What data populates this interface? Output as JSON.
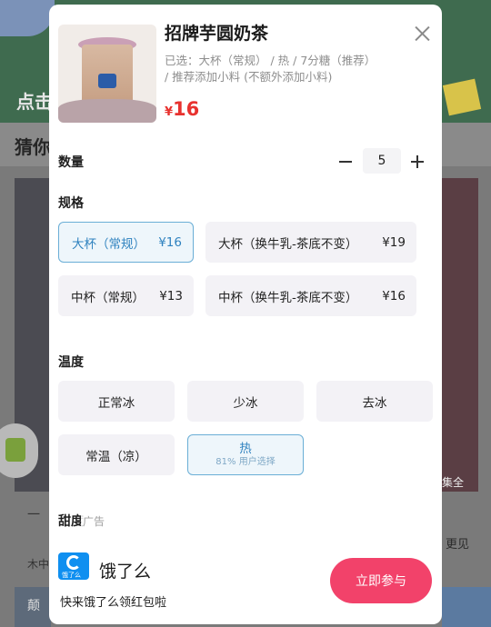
{
  "background": {
    "banner_text": "点击",
    "section_title": "猜你",
    "right_caption": "集全",
    "right_text": "更见",
    "left_meta1": "一",
    "left_meta2": "木中",
    "left_bar_text": "颠"
  },
  "product": {
    "name": "招牌芋圆奶茶",
    "selected_line1": "已选：大杯（常规） / 热 / 7分糖（推荐）",
    "selected_line2": "/ 推荐添加小料 (不额外添加小料)",
    "price_currency": "¥",
    "price_value": "16"
  },
  "quantity": {
    "label": "数量",
    "value": "5"
  },
  "spec": {
    "label": "规格",
    "options": [
      {
        "name": "大杯（常规）",
        "price": "¥16"
      },
      {
        "name": "大杯（换牛乳-茶底不变）",
        "price": "¥19"
      },
      {
        "name": "中杯（常规）",
        "price": "¥13"
      },
      {
        "name": "中杯（换牛乳-茶底不变）",
        "price": "¥16"
      }
    ]
  },
  "temperature": {
    "label": "温度",
    "options": [
      "正常冰",
      "少冰",
      "去冰",
      "常温（凉）",
      "热"
    ],
    "hot_sub": "81% 用户选择"
  },
  "ad": {
    "sweetness_label": "甜度",
    "tag": "广告",
    "logo_caption": "饿了么",
    "brand": "饿了么",
    "description": "快来饿了么领红包啦",
    "cta": "立即参与"
  },
  "colors": {
    "accent_price": "#e8322f",
    "selected_border": "#6aaed6",
    "cta": "#f2426a"
  }
}
